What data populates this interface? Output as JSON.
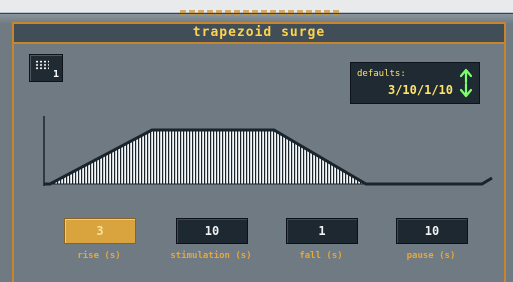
{
  "window": {
    "title": "trapezoid surge"
  },
  "keypad": {
    "number": "1"
  },
  "defaults": {
    "label": "defaults:",
    "value": "3/10/1/10"
  },
  "params": [
    {
      "value": "3",
      "caption": "rise (s)",
      "active": true
    },
    {
      "value": "10",
      "caption": "stimulation (s)",
      "active": false
    },
    {
      "value": "1",
      "caption": "fall (s)",
      "active": false
    },
    {
      "value": "10",
      "caption": "pause (s)",
      "active": false
    }
  ],
  "colors": {
    "accent": "#c9852a",
    "title_text": "#ffd24c",
    "active_button": "#d9a43d"
  }
}
